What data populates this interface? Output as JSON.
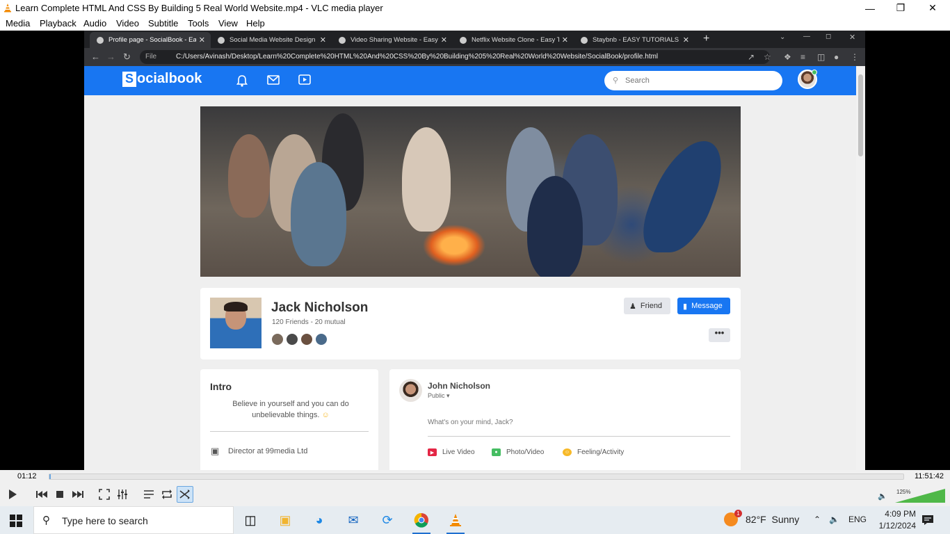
{
  "vlc": {
    "title": "Learn Complete HTML And CSS By Building 5 Real World Website.mp4 - VLC media player",
    "menu": [
      "Media",
      "Playback",
      "Audio",
      "Video",
      "Subtitle",
      "Tools",
      "View",
      "Help"
    ],
    "current_time": "01:12",
    "total_time": "11:51:42",
    "progress": 0.0017,
    "volume_label": "125%",
    "volume_level": 1.25
  },
  "browser": {
    "tabs": [
      {
        "label": "Profile page - SocialBook - Easy",
        "active": true
      },
      {
        "label": "Social Media Website Design - Ea",
        "active": false
      },
      {
        "label": "Video Sharing Website - Easy Tu",
        "active": false
      },
      {
        "label": "Netflix Website Clone - Easy Tuto",
        "active": false
      },
      {
        "label": "Staybnb - EASY TUTORIALS",
        "active": false
      }
    ],
    "url_prefix": "File",
    "url": "C:/Users/Avinash/Desktop/Learn%20Complete%20HTML%20And%20CSS%20By%20Building%205%20Real%20World%20Website/SocialBook/profile.html"
  },
  "site": {
    "logo_s": "S",
    "logo_rest": "ocialbook",
    "search_placeholder": "Search",
    "profile": {
      "name": "Jack Nicholson",
      "friends": "120 Friends - 20 mutual",
      "friend_button": "Friend",
      "message_button": "Message",
      "more": "•••"
    },
    "intro": {
      "title": "Intro",
      "bio": "Believe in yourself and you can do unbelievable things.",
      "job": "Director at 99media Ltd"
    },
    "composer": {
      "name": "John Nicholson",
      "visibility": "Public ▾",
      "placeholder": "What's on your mind, Jack?",
      "actions": [
        {
          "label": "Live Video",
          "color": "#e42645"
        },
        {
          "label": "Photo/Video",
          "color": "#45bd62"
        },
        {
          "label": "Feeling/Activity",
          "color": "#f7b928"
        }
      ]
    }
  },
  "taskbar": {
    "search_placeholder": "Type here to search",
    "weather_temp": "82°F",
    "weather_text": "Sunny",
    "weather_badge": "1",
    "lang": "ENG",
    "time": "4:09 PM",
    "date": "1/12/2024"
  },
  "colors": {
    "brand": "#1876f2",
    "vlc_orange": "#f38b00",
    "seek_fill": "#6aa6e0"
  }
}
